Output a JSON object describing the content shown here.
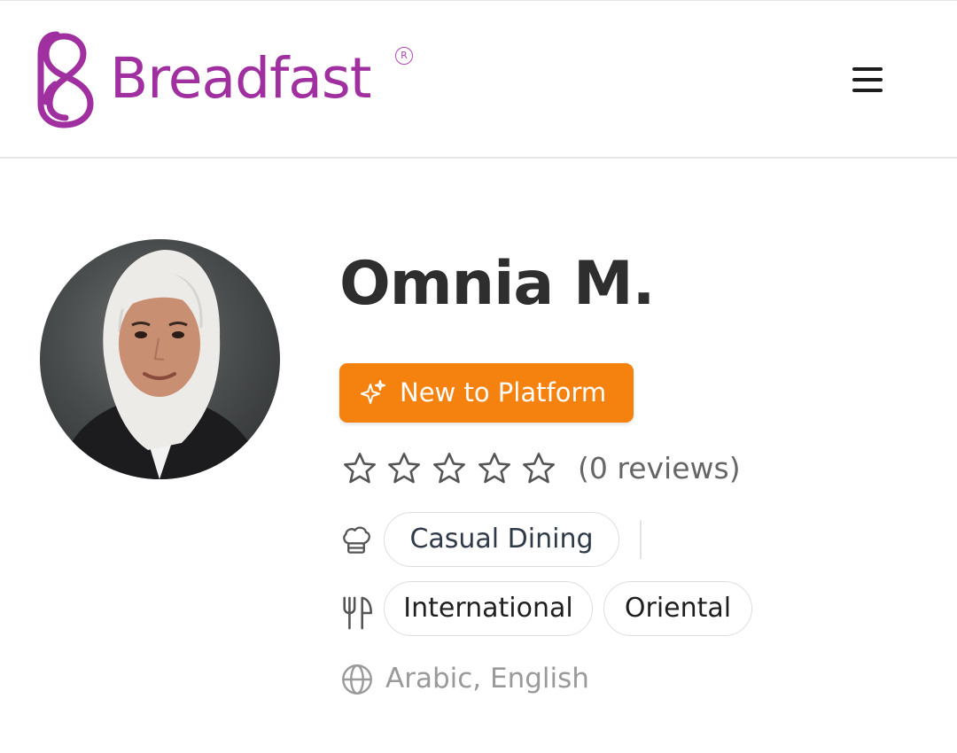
{
  "header": {
    "brand_name": "Breadfast",
    "registered_mark": "R",
    "brand_color": "#a02fa0",
    "menu_icon": "hamburger-menu-icon"
  },
  "profile": {
    "name": "Omnia M.",
    "avatar_icon": "chef-photo",
    "badge": {
      "label": "New to Platform",
      "icon": "sparkles-icon",
      "color": "#f5820f"
    },
    "rating": {
      "stars_filled": 0,
      "stars_total": 5,
      "review_text": "(0 reviews)"
    },
    "dining_type": {
      "icon": "chef-hat-icon",
      "tags": [
        "Casual Dining"
      ]
    },
    "cuisines": {
      "icon": "fork-knife-icon",
      "tags": [
        "International",
        "Oriental"
      ]
    },
    "languages": {
      "icon": "globe-icon",
      "text": "Arabic, English"
    }
  }
}
